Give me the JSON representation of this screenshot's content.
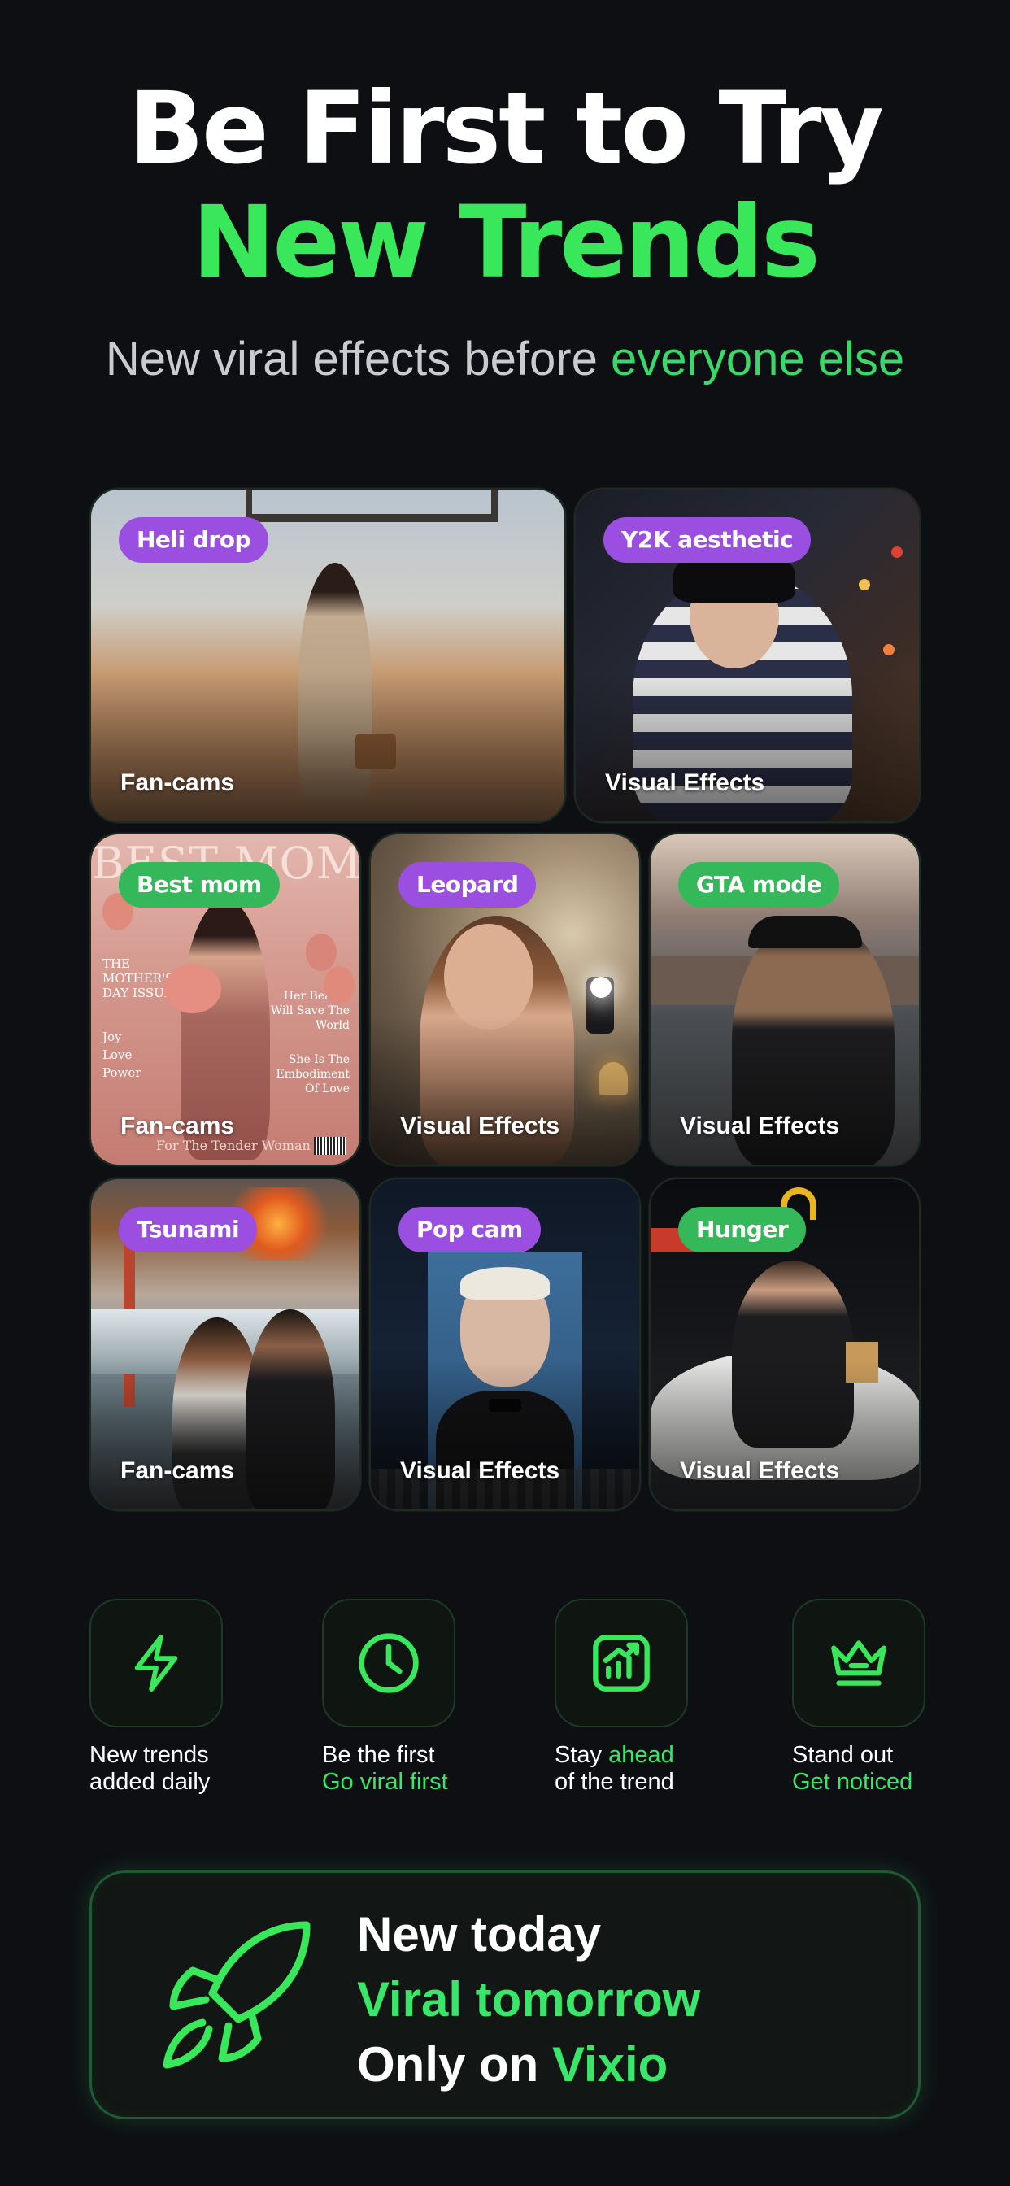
{
  "hero": {
    "line1": "Be First to Try",
    "line2": "New Trends",
    "subtitle_main": "New viral effects before ",
    "subtitle_accent": "everyone else"
  },
  "cards": [
    {
      "tag": "Heli drop",
      "caption": "Fan-cams",
      "tag_color": "purple"
    },
    {
      "tag": "Y2K aesthetic",
      "caption": "Visual Effects",
      "tag_color": "purple"
    },
    {
      "tag": "Best mom",
      "caption": "Fan-cams",
      "tag_color": "green"
    },
    {
      "tag": "Leopard",
      "caption": "Visual Effects",
      "tag_color": "purple"
    },
    {
      "tag": "GTA mode",
      "caption": "Visual Effects",
      "tag_color": "green"
    },
    {
      "tag": "Tsunami",
      "caption": "Fan-cams",
      "tag_color": "purple"
    },
    {
      "tag": "Pop cam",
      "caption": "Visual Effects",
      "tag_color": "purple"
    },
    {
      "tag": "Hunger",
      "caption": "Visual Effects",
      "tag_color": "green"
    }
  ],
  "magazine": {
    "title": "BEST MOM",
    "left_text": "THE MOTHER'S DAY ISSUE",
    "left_words": "Joy Love Power",
    "right_text1": "Her Beauty Will Save The World",
    "right_text2": "She Is The Embodiment Of Love",
    "footer": "For The Tender Woman"
  },
  "features": [
    {
      "icon": "lightning-icon",
      "line1": "New trends",
      "line2": "added daily",
      "line2_green": false
    },
    {
      "icon": "clock-icon",
      "line1": "Be the first",
      "line2": "Go viral first",
      "line2_green": true
    },
    {
      "icon": "chart-icon",
      "line1_a": "Stay ",
      "line1_b": "ahead",
      "line2": "of the trend"
    },
    {
      "icon": "crown-icon",
      "line1": "Stand out",
      "line2": "Get noticed",
      "line2_green": true
    }
  ],
  "cta": {
    "line1": "New today",
    "line2": "Viral tomorrow",
    "line3_a": "Only on ",
    "line3_b": "Vixio"
  },
  "colors": {
    "background": "#0e0f13",
    "accent_green": "#39e85a",
    "tag_purple": "#9b4fe0",
    "tag_green": "#35b85a"
  }
}
